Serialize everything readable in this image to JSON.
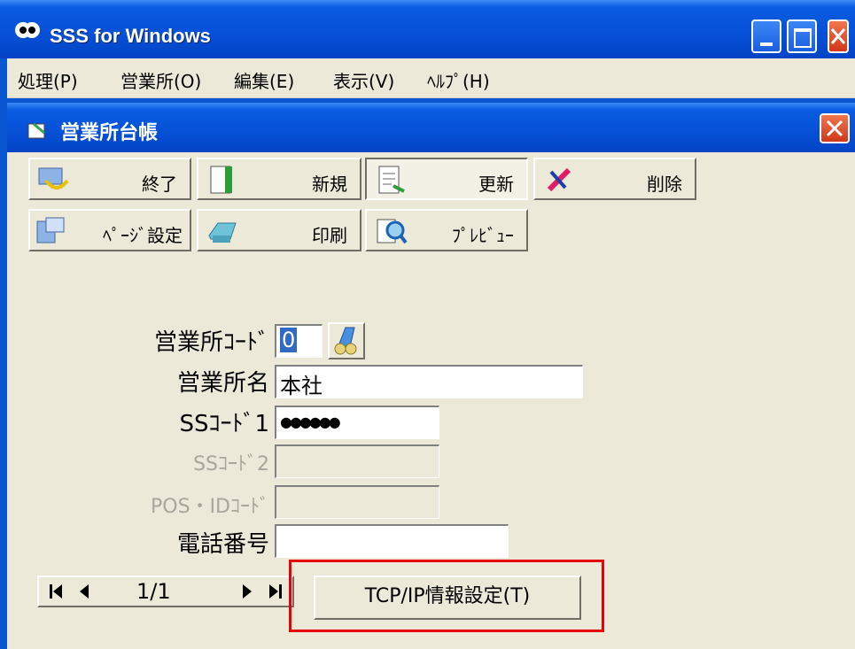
{
  "window": {
    "title": "SSS for Windows"
  },
  "menu": [
    "処理(P)",
    "営業所(O)",
    "編集(E)",
    "表示(V)",
    "ﾍﾙﾌﾟ(H)"
  ],
  "child_window": {
    "title": "営業所台帳"
  },
  "toolbar": {
    "exit": "終了",
    "new": "新規",
    "update": "更新",
    "delete": "削除",
    "page_setup": "ﾍﾟｰｼﾞ設定",
    "print": "印刷",
    "preview": "ﾌﾟﾚﾋﾞｭｰ"
  },
  "form": {
    "office_code_label": "営業所ｺｰﾄﾞ",
    "office_code_value": "0",
    "office_name_label": "営業所名",
    "office_name_value": "本社",
    "ss_code1_label": "SSｺｰﾄﾞ1",
    "ss_code1_value": "●●●●●●",
    "ss_code2_label": "SSｺｰﾄﾞ2",
    "ss_code2_value": "",
    "pos_id_label": "POS・IDｺｰﾄﾞ",
    "pos_id_value": "",
    "phone_label": "電話番号",
    "phone_value": ""
  },
  "nav": {
    "page": "1/1"
  },
  "tcp_button": "TCP/IP情報設定(T)"
}
